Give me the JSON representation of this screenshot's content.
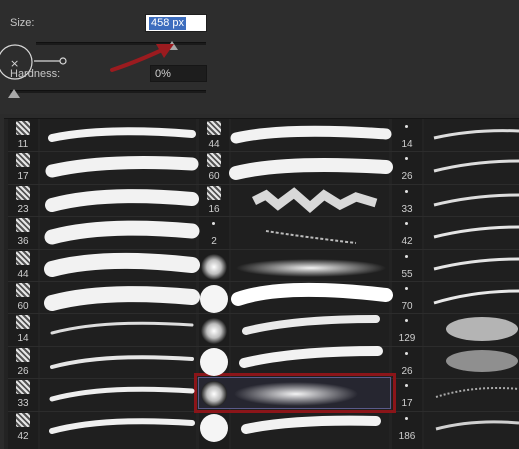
{
  "size": {
    "label": "Size:",
    "value": "458 px",
    "level": 0.8
  },
  "hardness": {
    "label": "Hardness:",
    "value": "0%",
    "level": 0.0
  },
  "brush_cursor": {
    "icon": "x-crosshair-icon"
  },
  "annotation": {
    "icon": "red-arrow-icon",
    "color": "#9b1b1f"
  },
  "presets": {
    "col1": [
      "11",
      "17",
      "23",
      "36",
      "44",
      "60",
      "14",
      "26",
      "33",
      "42"
    ],
    "col2": [
      "44",
      "60",
      "16",
      "2",
      "",
      "",
      "",
      "",
      "",
      ""
    ],
    "col3": [
      "14",
      "26",
      "33",
      "42",
      "55",
      "70",
      "129",
      "26",
      "17",
      "186"
    ],
    "selected": {
      "column": 2,
      "row": 8
    }
  }
}
